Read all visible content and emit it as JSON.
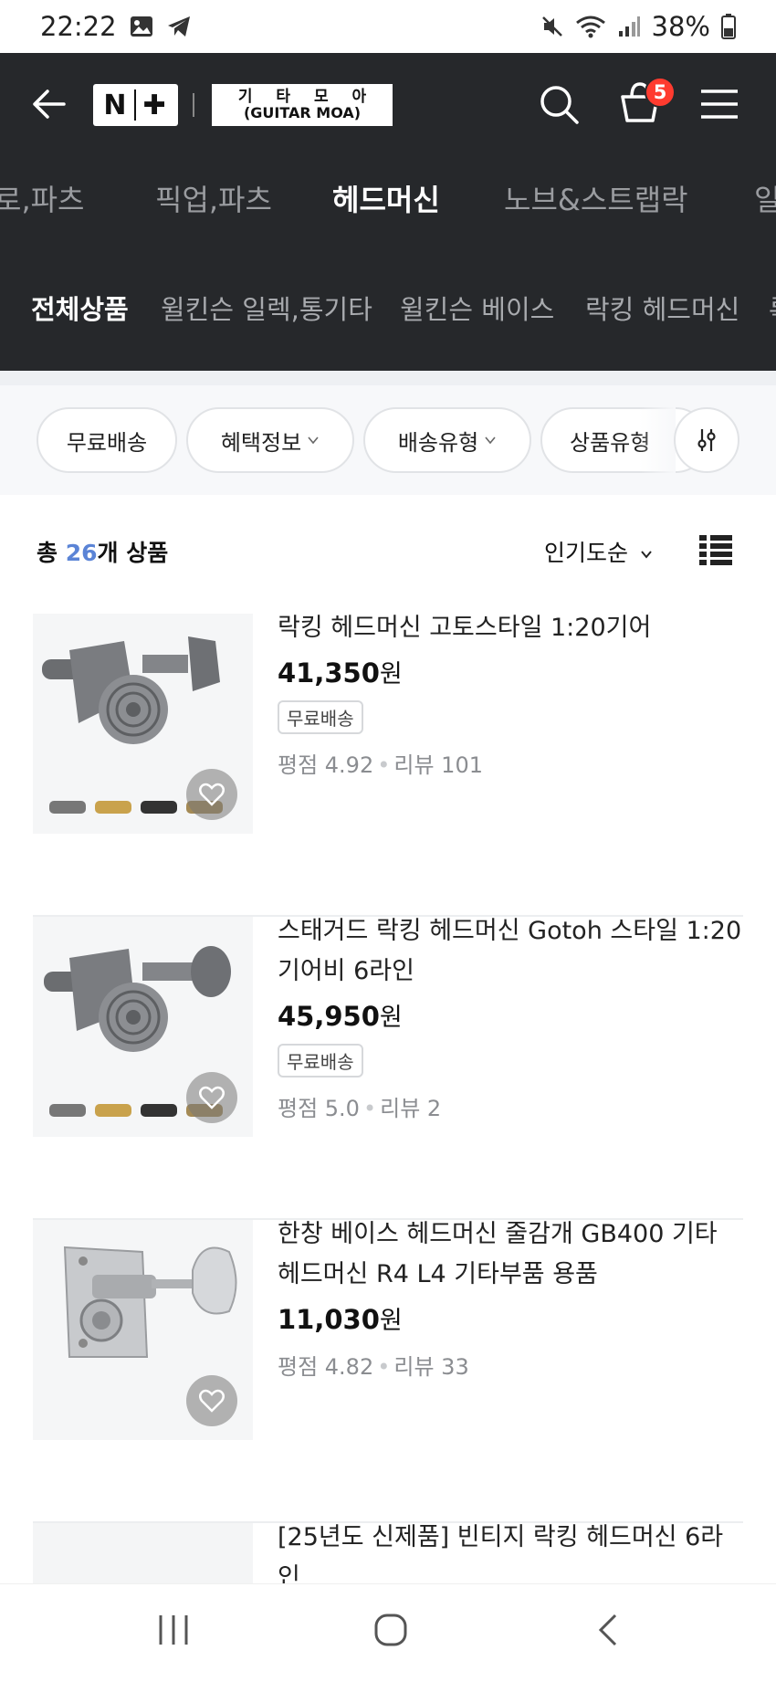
{
  "status_bar": {
    "time": "22:22",
    "battery": "38%"
  },
  "header": {
    "logo_text": "N+",
    "store_name_line1": "기 타 모 아",
    "store_name_line2": "(GUITAR MOA)",
    "cart_count": "5"
  },
  "categories": [
    "로,파츠",
    "픽업,파츠",
    "헤드머신",
    "노브&스트랩락",
    "일"
  ],
  "subcategories": [
    "전체상품",
    "윌킨슨 일렉,통기타",
    "윌킨슨 베이스",
    "락킹 헤드머신",
    "록"
  ],
  "filters": {
    "chips": [
      "무료배송",
      "혜택정보",
      "배송유형",
      "상품유형"
    ]
  },
  "summary": {
    "total_prefix": "총 ",
    "total_count": "26",
    "total_suffix": "개 상품",
    "sort_label": "인기도순"
  },
  "products": [
    {
      "name": "락킹 헤드머신 고토스타일 1:20기어",
      "price": "41,350",
      "currency": "원",
      "badge": "무료배송",
      "rating_label": "평점 4.92",
      "review_label": "리뷰 101"
    },
    {
      "name": "스태거드 락킹 헤드머신 Gotoh 스타일 1:20 기어비 6라인",
      "price": "45,950",
      "currency": "원",
      "badge": "무료배송",
      "rating_label": "평점 5.0",
      "review_label": "리뷰 2"
    },
    {
      "name": "한창 베이스 헤드머신 줄감개 GB400 기타 헤드머신 R4 L4 기타부품 용품",
      "price": "11,030",
      "currency": "원",
      "badge": "",
      "rating_label": "평점 4.82",
      "review_label": "리뷰 33"
    },
    {
      "name": "[25년도 신제품] 빈티지 락킹 헤드머신 6라인",
      "price": "",
      "currency": "",
      "badge": "",
      "rating_label": "",
      "review_label": ""
    }
  ],
  "colors": {
    "header_bg": "#26282b",
    "accent_count": "#5b84d6",
    "badge_red": "#ff3b2f"
  }
}
